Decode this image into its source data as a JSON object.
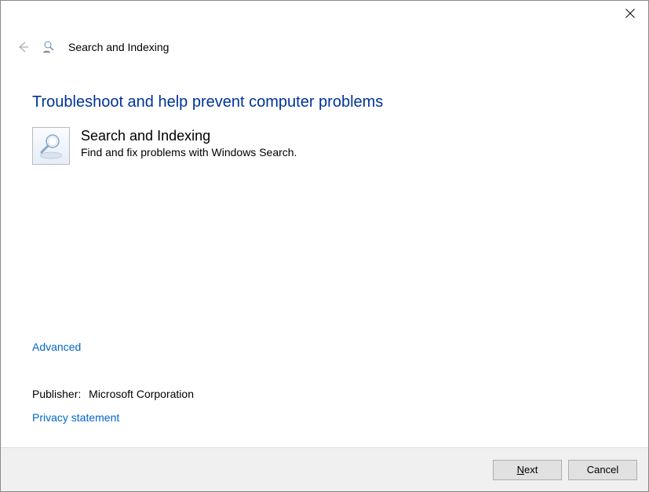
{
  "header": {
    "title": "Search and Indexing"
  },
  "main": {
    "heading": "Troubleshoot and help prevent computer problems",
    "item": {
      "title": "Search and Indexing",
      "description": "Find and fix problems with Windows Search."
    }
  },
  "links": {
    "advanced": "Advanced",
    "privacy": "Privacy statement"
  },
  "publisher": {
    "label": "Publisher:",
    "value": "Microsoft Corporation"
  },
  "footer": {
    "next_prefix": "N",
    "next_suffix": "ext",
    "cancel": "Cancel"
  }
}
